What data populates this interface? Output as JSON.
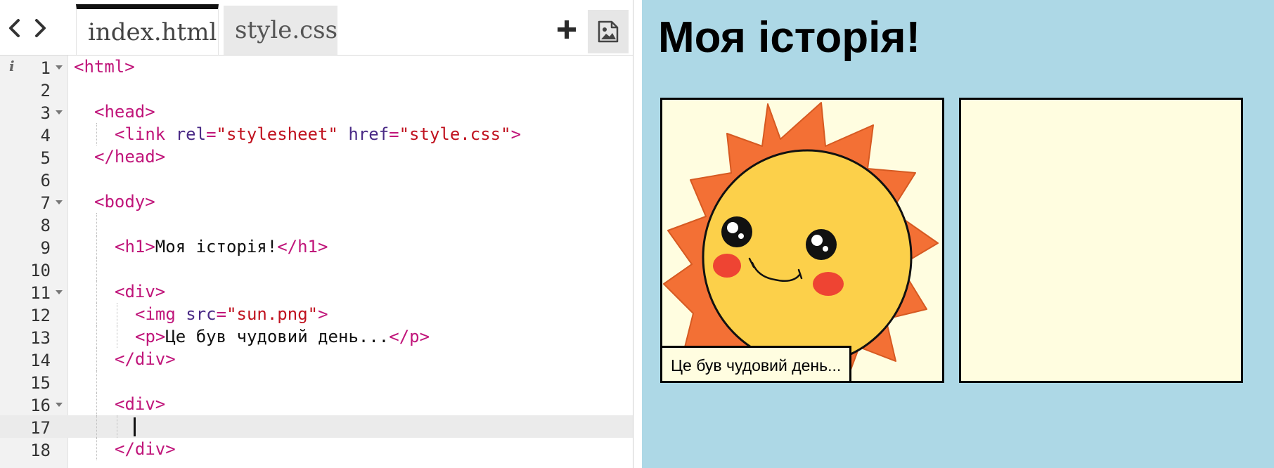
{
  "tabs": {
    "index_label": "index.html",
    "style_label": "style.css"
  },
  "icons": {
    "back": "chevron-left-icon",
    "forward": "chevron-right-icon",
    "add": "plus-icon",
    "image": "image-icon",
    "info": "info-icon"
  },
  "editor": {
    "active_line": 17,
    "lines": [
      {
        "num": "1",
        "text": "<html>"
      },
      {
        "num": "2",
        "text": ""
      },
      {
        "num": "3",
        "text": "<head>"
      },
      {
        "num": "4",
        "text": "<link rel=\"stylesheet\" href=\"style.css\">"
      },
      {
        "num": "5",
        "text": "</head>"
      },
      {
        "num": "6",
        "text": ""
      },
      {
        "num": "7",
        "text": "<body>"
      },
      {
        "num": "8",
        "text": ""
      },
      {
        "num": "9",
        "text": "<h1>Моя історія!</h1>"
      },
      {
        "num": "10",
        "text": ""
      },
      {
        "num": "11",
        "text": "<div>"
      },
      {
        "num": "12",
        "text": "<img src=\"sun.png\">"
      },
      {
        "num": "13",
        "text": "<p>Це був чудовий день...</p>"
      },
      {
        "num": "14",
        "text": "</div>"
      },
      {
        "num": "15",
        "text": ""
      },
      {
        "num": "16",
        "text": "<div>"
      },
      {
        "num": "17",
        "text": ""
      },
      {
        "num": "18",
        "text": "</div>"
      }
    ]
  },
  "preview": {
    "title": "Моя історія!",
    "caption": "Це був чудовий день...",
    "colors": {
      "background": "#add8e6",
      "panel": "#fffde0",
      "sun_rays": "#f37035",
      "sun_face": "#fcd04a",
      "cheeks": "#ee4433"
    }
  },
  "syntax_colors": {
    "tag": "#c0157a",
    "attribute": "#4a2a86",
    "string": "#c0121f",
    "text": "#111111"
  }
}
